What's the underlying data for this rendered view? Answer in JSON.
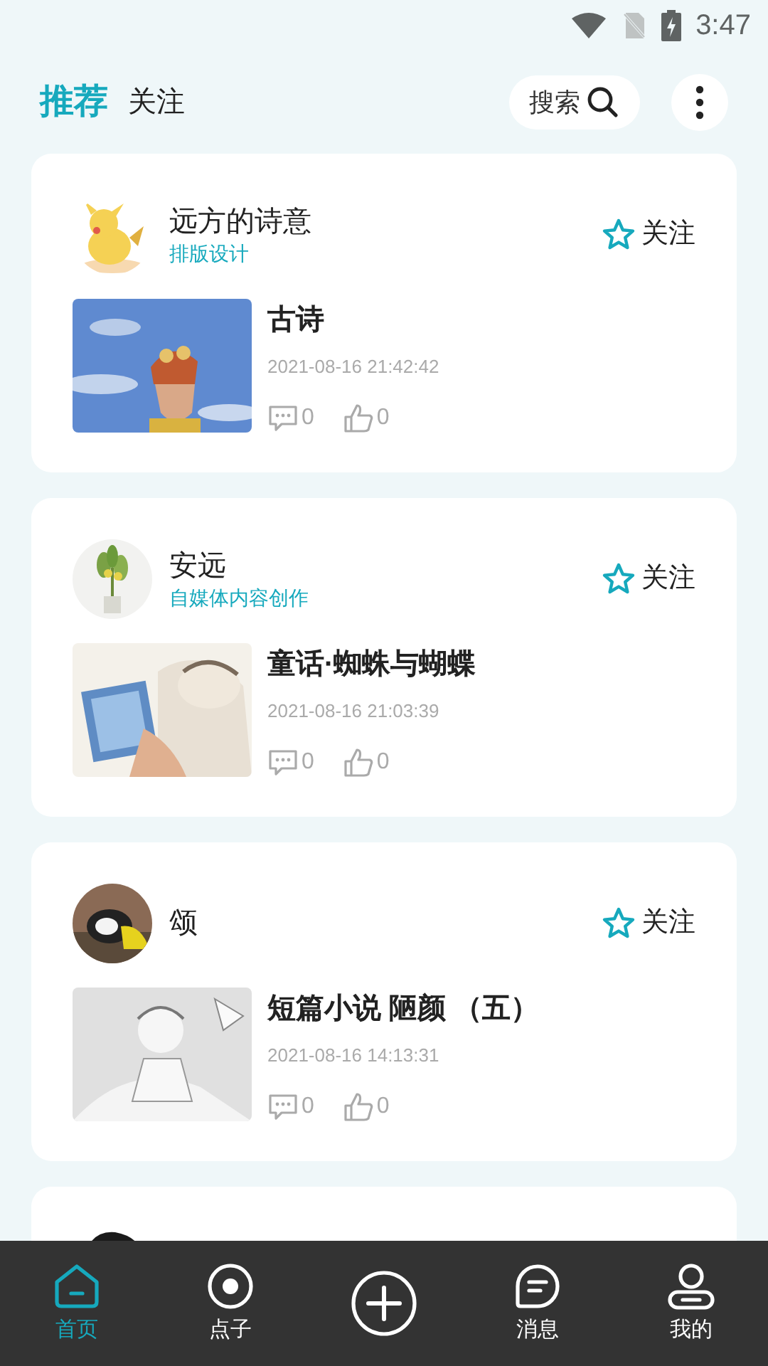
{
  "status_bar": {
    "time": "3:47"
  },
  "tabs": [
    {
      "label": "推荐",
      "selected": true
    },
    {
      "label": "关注",
      "selected": false
    }
  ],
  "search": {
    "label": "搜索"
  },
  "posts": [
    {
      "author": "远方的诗意",
      "tag": "排版设计",
      "follow": "关注",
      "followed": false,
      "title": "古诗",
      "date": "2021-08-16 21:42:42",
      "comments": "0",
      "likes": "0"
    },
    {
      "author": "安远",
      "tag": "自媒体内容创作",
      "follow": "关注",
      "followed": false,
      "title": "童话·蜘蛛与蝴蝶",
      "date": "2021-08-16 21:03:39",
      "comments": "0",
      "likes": "0"
    },
    {
      "author": "颂",
      "follow": "关注",
      "followed": false,
      "title": "短篇小说 陋颜 （五）",
      "date": "2021-08-16 14:13:31",
      "comments": "0",
      "likes": "0"
    }
  ],
  "nav": [
    {
      "label": "首页",
      "kind": "home",
      "selected": true
    },
    {
      "label": "点子",
      "kind": "idea",
      "selected": false
    },
    {
      "kind": "add",
      "selected": false
    },
    {
      "label": "消息",
      "kind": "message",
      "selected": false
    },
    {
      "label": "我的",
      "kind": "profile",
      "selected": false
    }
  ]
}
